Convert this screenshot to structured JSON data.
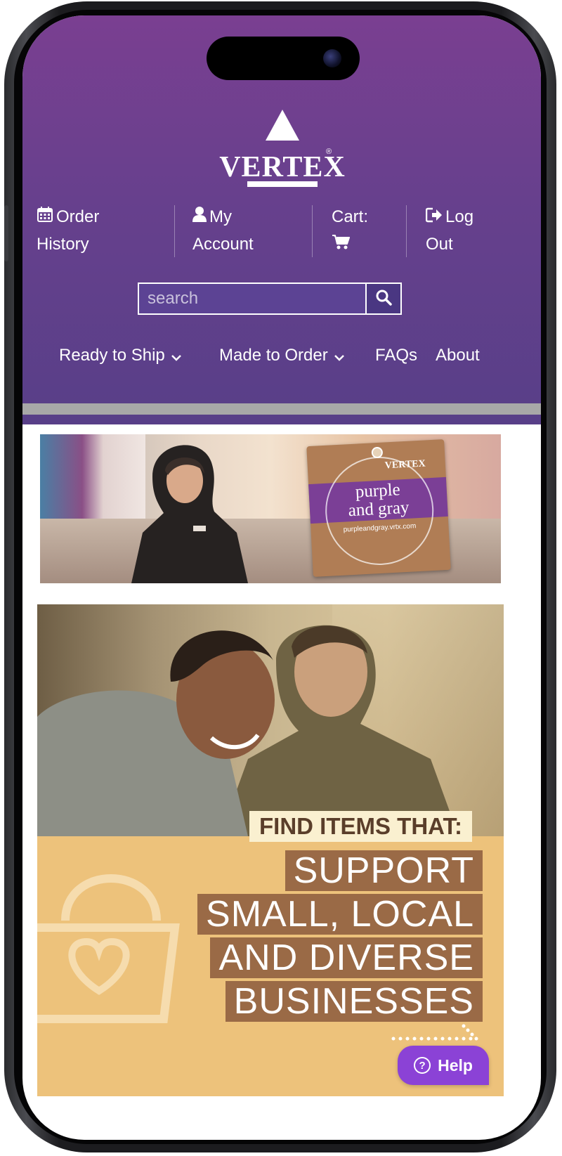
{
  "header": {
    "logo_text": "VERTEX",
    "logo_reg": "®",
    "top_links": [
      {
        "icon": "calendar-icon",
        "line1": "Order",
        "line2": "History"
      },
      {
        "icon": "user-icon",
        "line1": "My",
        "line2": "Account"
      },
      {
        "icon": "cart-icon",
        "line1": "Cart:",
        "line2": ""
      },
      {
        "icon": "logout-icon",
        "line1": "Log",
        "line2": "Out"
      }
    ],
    "search": {
      "placeholder": "search"
    },
    "nav": [
      {
        "label": "Ready to Ship",
        "has_dropdown": true
      },
      {
        "label": "Made to Order",
        "has_dropdown": true
      },
      {
        "label": "FAQs",
        "has_dropdown": false
      },
      {
        "label": "About",
        "has_dropdown": false
      }
    ],
    "colors": {
      "header_top": "#7a3f91",
      "header_bottom": "#583f88",
      "help_button": "#8b42d6"
    }
  },
  "banner_tag": {
    "brand": "VERTEX",
    "title_line1": "purple",
    "title_line2": "and gray",
    "url": "purpleandgray.vrtx.com"
  },
  "banner_main": {
    "kicker": "FIND ITEMS THAT:",
    "lines": [
      "SUPPORT",
      "SMALL, LOCAL",
      "AND DIVERSE",
      "BUSINESSES"
    ]
  },
  "help": {
    "label": "Help"
  }
}
